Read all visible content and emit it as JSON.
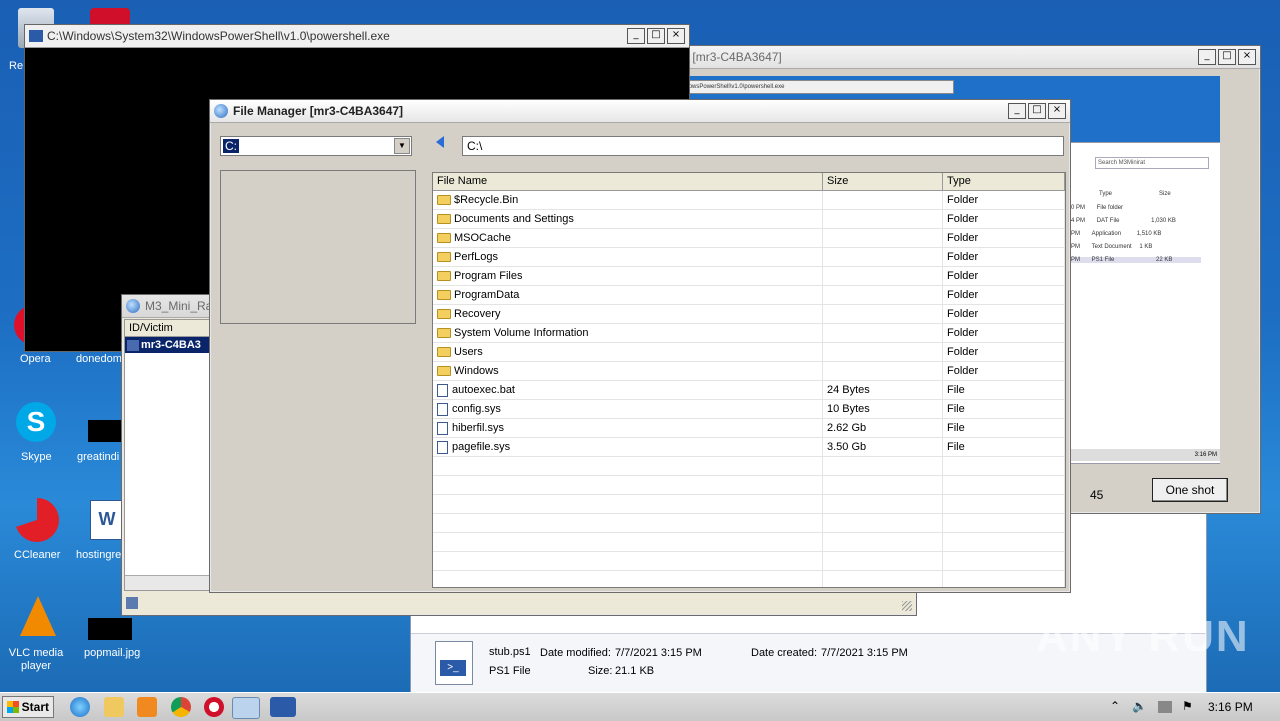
{
  "desktop": {
    "icons": [
      {
        "label": "Re"
      },
      {
        "label": "Opera"
      },
      {
        "label": "donedom"
      },
      {
        "label": "Skype"
      },
      {
        "label": "greatindi"
      },
      {
        "label": "CCleaner"
      },
      {
        "label": "hostingre"
      },
      {
        "label": "VLC media player"
      },
      {
        "label": "popmail.jpg"
      }
    ],
    "watermark": "ANY RUN"
  },
  "powershell_window": {
    "title": "C:\\Windows\\System32\\WindowsPowerShell\\v1.0\\powershell.exe"
  },
  "screenshot_window": {
    "title": "Screen Shot [mr3-C4BA3647]",
    "counter": "45",
    "one_shot_label": "One shot",
    "inner_title": "C:\\Windows\\System32\\WindowsPowerShell\\v1.0\\powershell.exe",
    "search_placeholder": "Search M3Minirat",
    "inner_columns": [
      "Type",
      "Size"
    ],
    "inner_rows": [
      {
        "time": "0 PM",
        "type": "File folder",
        "size": ""
      },
      {
        "time": "4 PM",
        "type": "DAT File",
        "size": "1,030 KB"
      },
      {
        "time": "PM",
        "type": "Application",
        "size": "1,510 KB"
      },
      {
        "time": "PM",
        "type": "Text Document",
        "size": "1 KB"
      },
      {
        "time": "PM",
        "type": "PS1 File",
        "size": "22 KB"
      }
    ],
    "inner_clock": "3:16 PM"
  },
  "mini_rat_window": {
    "title": "M3_Mini_Ra",
    "column": "ID/Victim",
    "row": "mr3-C4BA3"
  },
  "file_manager": {
    "title": "File Manager [mr3-C4BA3647]",
    "drive": "C:",
    "path": "C:\\",
    "columns": [
      "File Name",
      "Size",
      "Type"
    ],
    "rows": [
      {
        "name": "$Recycle.Bin",
        "size": "",
        "type": "Folder",
        "kind": "folder"
      },
      {
        "name": "Documents and Settings",
        "size": "",
        "type": "Folder",
        "kind": "folder"
      },
      {
        "name": "MSOCache",
        "size": "",
        "type": "Folder",
        "kind": "folder"
      },
      {
        "name": "PerfLogs",
        "size": "",
        "type": "Folder",
        "kind": "folder"
      },
      {
        "name": "Program Files",
        "size": "",
        "type": "Folder",
        "kind": "folder"
      },
      {
        "name": "ProgramData",
        "size": "",
        "type": "Folder",
        "kind": "folder"
      },
      {
        "name": "Recovery",
        "size": "",
        "type": "Folder",
        "kind": "folder"
      },
      {
        "name": "System Volume Information",
        "size": "",
        "type": "Folder",
        "kind": "folder"
      },
      {
        "name": "Users",
        "size": "",
        "type": "Folder",
        "kind": "folder"
      },
      {
        "name": "Windows",
        "size": "",
        "type": "Folder",
        "kind": "folder"
      },
      {
        "name": "autoexec.bat",
        "size": "24 Bytes",
        "type": "File",
        "kind": "file"
      },
      {
        "name": "config.sys",
        "size": "10 Bytes",
        "type": "File",
        "kind": "file"
      },
      {
        "name": "hiberfil.sys",
        "size": "2.62 Gb",
        "type": "File",
        "kind": "file"
      },
      {
        "name": "pagefile.sys",
        "size": "3.50 Gb",
        "type": "File",
        "kind": "file"
      }
    ],
    "empty_rows": 8
  },
  "explorer_details": {
    "file_name": "stub.ps1",
    "modified_label": "Date modified:",
    "modified": "7/7/2021 3:15 PM",
    "created_label": "Date created:",
    "created": "7/7/2021 3:15 PM",
    "type": "PS1 File",
    "size_label": "Size:",
    "size": "21.1 KB"
  },
  "taskbar": {
    "start_label": "Start",
    "clock": "3:16 PM"
  },
  "colors": {
    "desktop": "#1d6fc4",
    "selection": "#0a246a",
    "folder": "#f2cf5e"
  }
}
